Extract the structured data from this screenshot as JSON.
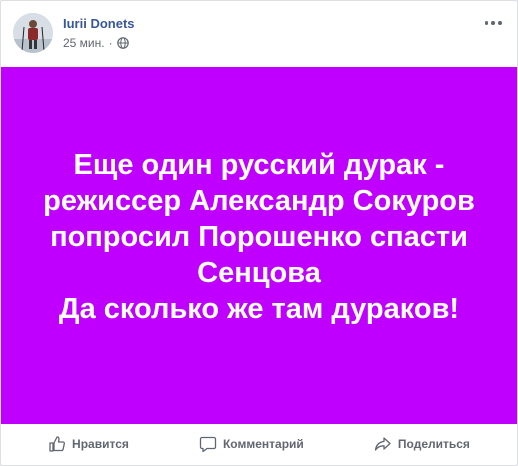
{
  "post": {
    "author": "Iurii Donets",
    "time": "25 мин.",
    "separator": "·",
    "audience_icon": "globe-icon",
    "text": "Еще один русский дурак -\nрежиссер Александр Сокуров\nпопросил Порошенко спасти\nСенцова\nДа сколько же там дураков!",
    "background_color": "#bf00ff"
  },
  "actions": {
    "like_label": "Нравится",
    "comment_label": "Комментарий",
    "share_label": "Поделиться"
  },
  "icons": {
    "like": "thumbs-up-icon",
    "comment": "comment-bubble-icon",
    "share": "share-arrow-icon",
    "more": "more-options-icon"
  }
}
